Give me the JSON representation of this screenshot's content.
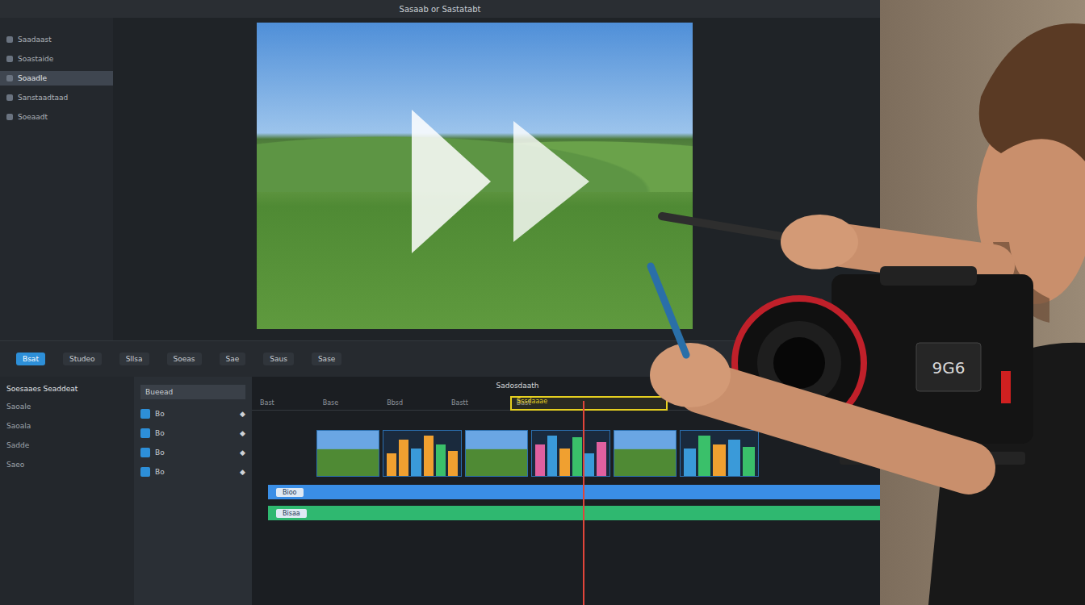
{
  "window": {
    "title": "Sasaab or Sastatabt"
  },
  "sidebar": {
    "items": [
      {
        "label": "Saadaast",
        "selected": false
      },
      {
        "label": "Soastaide",
        "selected": false
      },
      {
        "label": "Soaadle",
        "selected": true
      },
      {
        "label": "Sanstaadtaad",
        "selected": false
      },
      {
        "label": "Soeaadt",
        "selected": false
      }
    ]
  },
  "toolbar": {
    "items": [
      {
        "label": "Bsat",
        "selected": true
      },
      {
        "label": "Studeo",
        "selected": false
      },
      {
        "label": "Sllsa",
        "selected": false
      },
      {
        "label": "Soeas",
        "selected": false
      },
      {
        "label": "Sae",
        "selected": false
      },
      {
        "label": "Saus",
        "selected": false
      },
      {
        "label": "Sase",
        "selected": false
      }
    ]
  },
  "left_panel": {
    "title": "Soesaaes Seaddeat",
    "items": [
      "Saoale",
      "Saoala",
      "Sadde",
      "Saeo"
    ]
  },
  "tracks_panel": {
    "title": "Bueead",
    "rows": [
      "Bo",
      "Bo",
      "Bo",
      "Bo"
    ]
  },
  "timeline": {
    "title": "Sadosdaath",
    "ruler": [
      "Bast",
      "Base",
      "Bbsd",
      "Bastt",
      "Bast"
    ],
    "selection": {
      "label": "Sssdaaae"
    },
    "clips": [
      {
        "kind": "video",
        "bars": []
      },
      {
        "kind": "audio",
        "bars": [
          {
            "level": 0.5,
            "color": "#f0a030"
          },
          {
            "level": 0.8,
            "color": "#f0a030"
          },
          {
            "level": 0.6,
            "color": "#3a9ad9"
          },
          {
            "level": 0.9,
            "color": "#f0a030"
          },
          {
            "level": 0.7,
            "color": "#3ac06a"
          },
          {
            "level": 0.55,
            "color": "#f0a030"
          }
        ]
      },
      {
        "kind": "video",
        "bars": []
      },
      {
        "kind": "audio",
        "bars": [
          {
            "level": 0.7,
            "color": "#e060a0"
          },
          {
            "level": 0.9,
            "color": "#3a9ad9"
          },
          {
            "level": 0.6,
            "color": "#f0a030"
          },
          {
            "level": 0.85,
            "color": "#3ac06a"
          },
          {
            "level": 0.5,
            "color": "#3a9ad9"
          },
          {
            "level": 0.75,
            "color": "#e060a0"
          }
        ]
      },
      {
        "kind": "video",
        "bars": []
      },
      {
        "kind": "audio",
        "bars": [
          {
            "level": 0.6,
            "color": "#3a9ad9"
          },
          {
            "level": 0.9,
            "color": "#3ac06a"
          },
          {
            "level": 0.7,
            "color": "#f0a030"
          },
          {
            "level": 0.8,
            "color": "#3a9ad9"
          },
          {
            "level": 0.65,
            "color": "#3ac06a"
          }
        ]
      }
    ],
    "tracks": [
      {
        "label": "Bioo",
        "color": "#3a8ee6"
      },
      {
        "label": "Bisaa",
        "color": "#2fb870"
      }
    ]
  },
  "camera": {
    "label": "9G6"
  }
}
